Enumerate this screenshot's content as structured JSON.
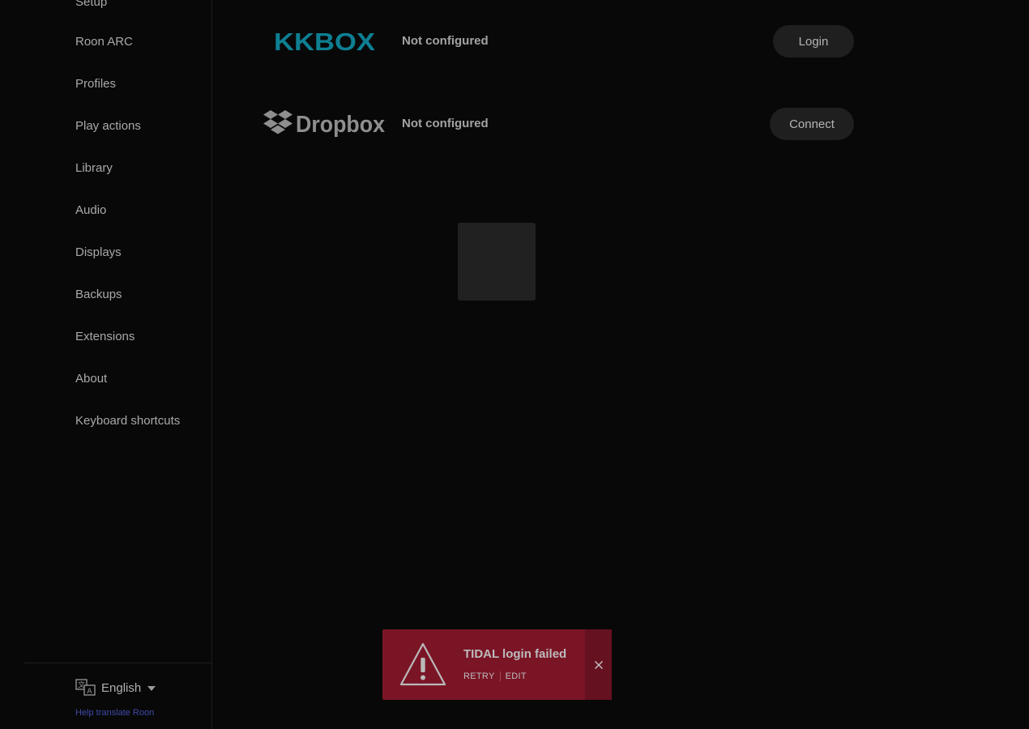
{
  "sidebar": {
    "items": [
      {
        "label": "Setup"
      },
      {
        "label": "Roon ARC"
      },
      {
        "label": "Profiles"
      },
      {
        "label": "Play actions"
      },
      {
        "label": "Library"
      },
      {
        "label": "Audio"
      },
      {
        "label": "Displays"
      },
      {
        "label": "Backups"
      },
      {
        "label": "Extensions"
      },
      {
        "label": "About"
      },
      {
        "label": "Keyboard shortcuts"
      }
    ],
    "language": {
      "label": "English",
      "icon": "translate-icon"
    },
    "help_link": "Help translate Roon"
  },
  "services": [
    {
      "logo_text": "KKBOX",
      "logo_color": "#0e7f93",
      "status": "Not configured",
      "button": "Login"
    },
    {
      "logo_text": "Dropbox",
      "logo_color": "#8e8e8e",
      "status": "Not configured",
      "button": "Connect"
    }
  ],
  "toast": {
    "title": "TIDAL login failed",
    "retry": "RETRY",
    "edit": "EDIT",
    "icon": "warning-icon",
    "close_icon": "close-icon",
    "background": "#7a1526"
  }
}
